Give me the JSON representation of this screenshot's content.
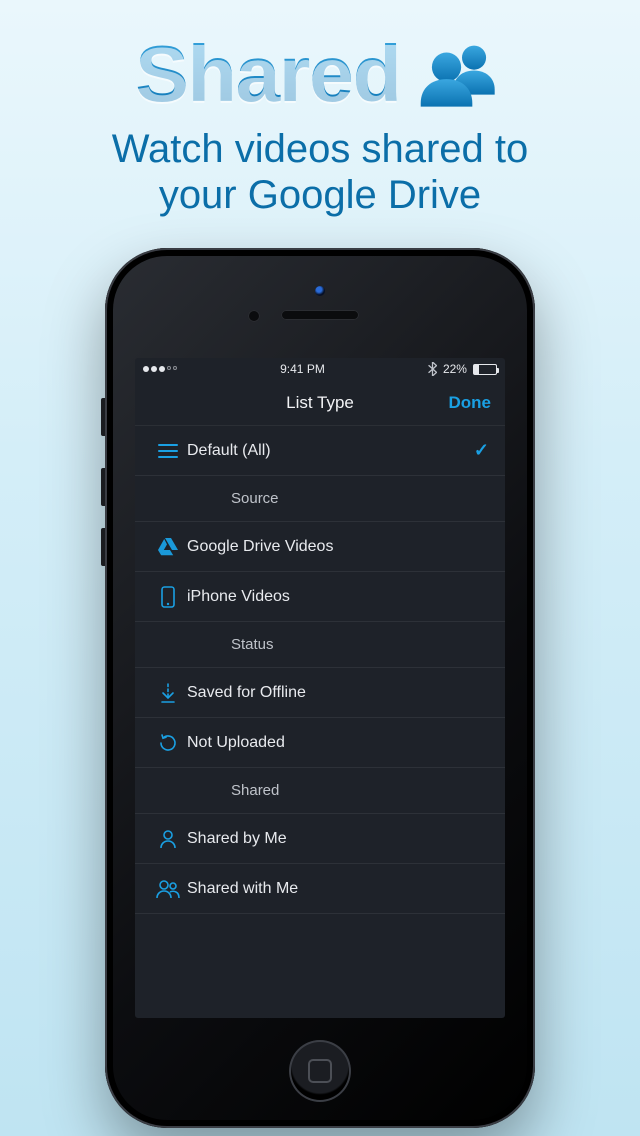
{
  "promo": {
    "title": "Shared",
    "subtitle_line1": "Watch videos shared to",
    "subtitle_line2": "your Google Drive"
  },
  "statusbar": {
    "signal_filled": 3,
    "signal_total": 5,
    "time": "9:41 PM",
    "battery_pct": "22%"
  },
  "navbar": {
    "title": "List Type",
    "done": "Done"
  },
  "list": {
    "default": {
      "label": "Default (All)",
      "selected": true
    },
    "section_source": "Source",
    "gdrive": "Google Drive Videos",
    "iphone": "iPhone Videos",
    "section_status": "Status",
    "offline": "Saved for Offline",
    "not_uploaded": "Not Uploaded",
    "section_shared": "Shared",
    "shared_by_me": "Shared by Me",
    "shared_with_me": "Shared with Me"
  }
}
